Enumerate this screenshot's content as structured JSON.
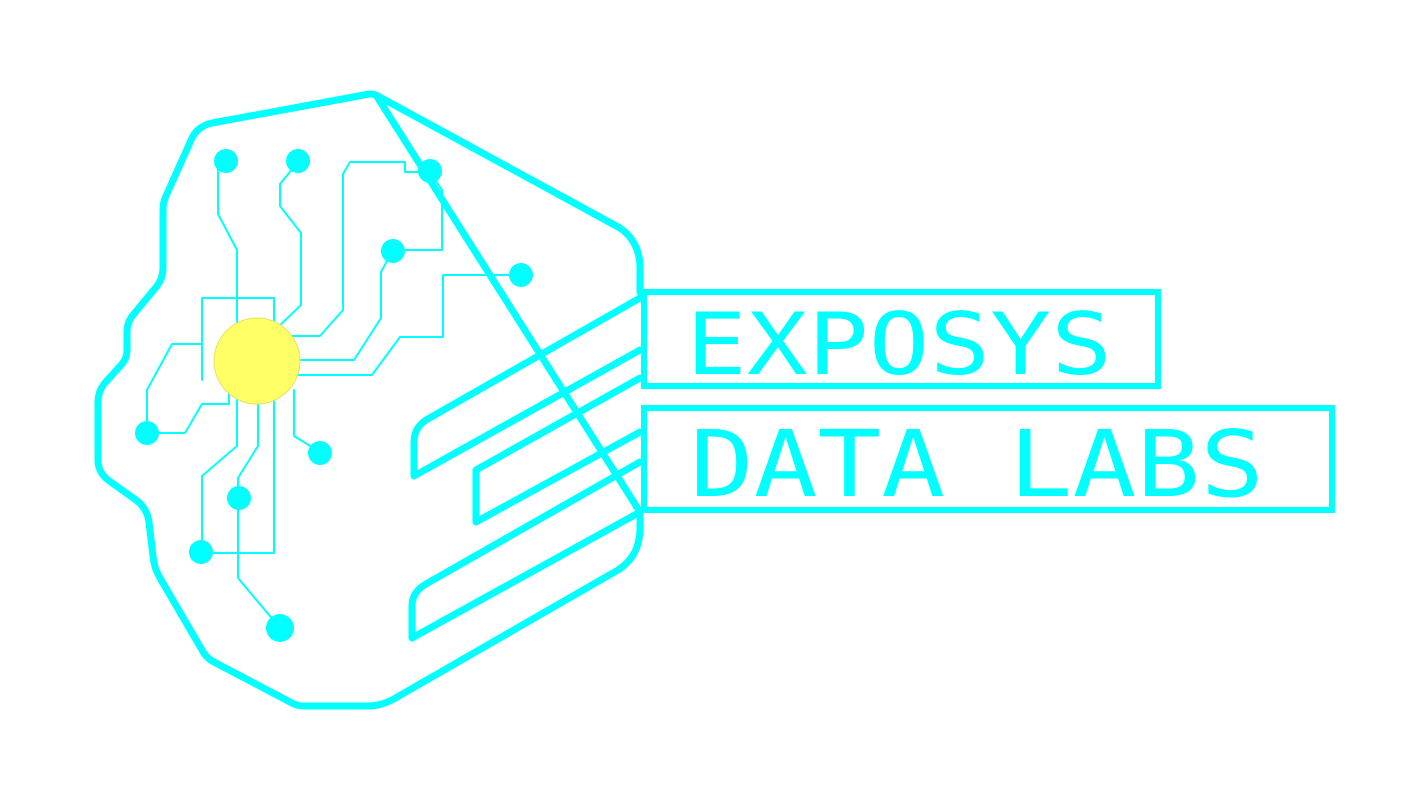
{
  "brand": {
    "line1": "EXPOSYS",
    "line2": "DATA LABS"
  },
  "colors": {
    "primary": "#00FFFF",
    "node_core": "#FFFF66",
    "node_core_stroke": "#E6E066",
    "background": "#FFFFFF"
  },
  "icons": {
    "logo": "brain-circuit-key-icon"
  }
}
